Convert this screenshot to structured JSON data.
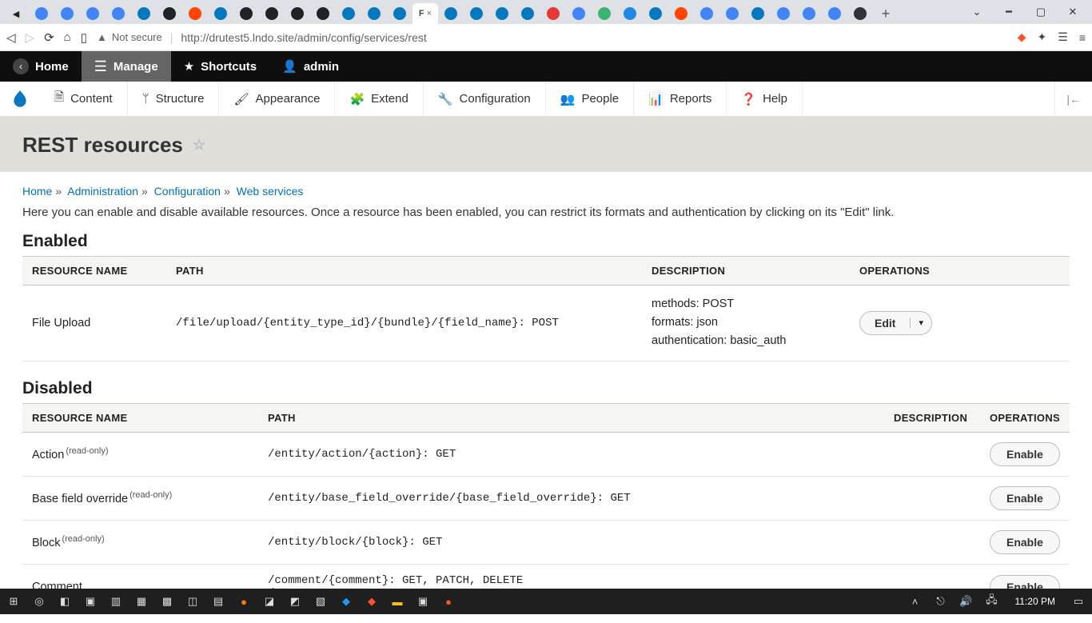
{
  "browser": {
    "not_secure": "Not secure",
    "url": "http://drutest5.lndo.site/admin/config/services/rest",
    "active_tab_letter": "F",
    "active_tab_close": "×"
  },
  "toolbar": {
    "home": "Home",
    "manage": "Manage",
    "shortcuts": "Shortcuts",
    "admin": "admin"
  },
  "admin_menu": {
    "content": "Content",
    "structure": "Structure",
    "appearance": "Appearance",
    "extend": "Extend",
    "configuration": "Configuration",
    "people": "People",
    "reports": "Reports",
    "help": "Help"
  },
  "page": {
    "title": "REST resources",
    "breadcrumb": {
      "home": "Home",
      "admin": "Administration",
      "config": "Configuration",
      "web": "Web services"
    },
    "intro": "Here you can enable and disable available resources. Once a resource has been enabled, you can restrict its formats and authentication by clicking on its \"Edit\" link.",
    "enabled_heading": "Enabled",
    "disabled_heading": "Disabled",
    "columns": {
      "resource": "RESOURCE NAME",
      "path": "PATH",
      "description": "DESCRIPTION",
      "operations": "OPERATIONS"
    },
    "buttons": {
      "edit": "Edit",
      "enable": "Enable"
    },
    "readonly_tag": "(read-only)",
    "enabled_rows": [
      {
        "name": "File Upload",
        "path": "/file/upload/{entity_type_id}/{bundle}/{field_name}: POST",
        "desc1": "methods: POST",
        "desc2": "formats: json",
        "desc3": "authentication: basic_auth"
      }
    ],
    "disabled_rows": [
      {
        "name": "Action",
        "readonly": true,
        "path": "/entity/action/{action}: GET"
      },
      {
        "name": "Base field override",
        "readonly": true,
        "path": "/entity/base_field_override/{base_field_override}: GET"
      },
      {
        "name": "Block",
        "readonly": true,
        "path": "/entity/block/{block}: GET"
      },
      {
        "name": "Comment",
        "readonly": false,
        "path": "/comment/{comment}: GET, PATCH, DELETE",
        "path2": "/comment: POST"
      }
    ]
  },
  "taskbar": {
    "time": "11:20 PM"
  }
}
